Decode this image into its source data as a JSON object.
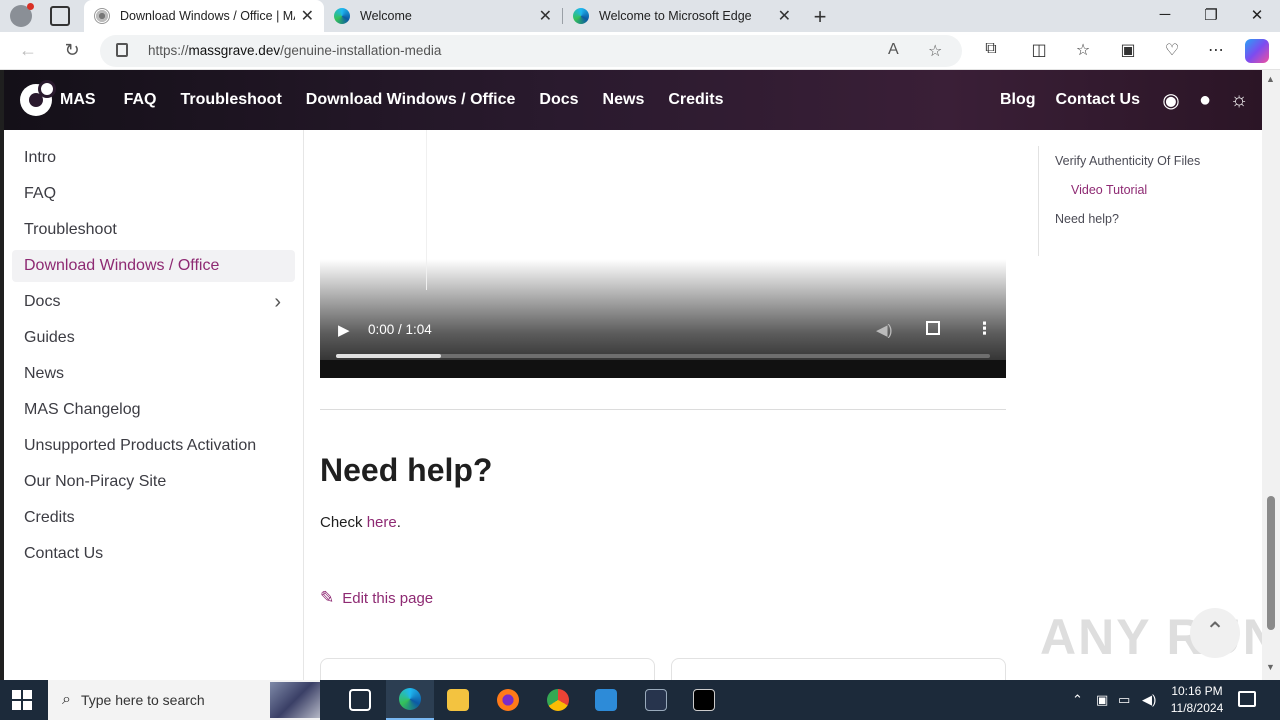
{
  "browser": {
    "tabs": [
      {
        "title": "Download Windows / Office | MAS",
        "active": true
      },
      {
        "title": "Welcome",
        "active": false
      },
      {
        "title": "Welcome to Microsoft Edge",
        "active": false
      }
    ],
    "url_prefix": "https://",
    "url_host": "massgrave.dev",
    "url_path": "/genuine-installation-media"
  },
  "site": {
    "brand": "MAS",
    "nav": [
      "FAQ",
      "Troubleshoot",
      "Download Windows / Office",
      "Docs",
      "News",
      "Credits"
    ],
    "nav_right": [
      "Blog",
      "Contact Us"
    ],
    "nav_icons": [
      "discord-icon",
      "github-icon",
      "theme-sun-icon"
    ],
    "accent_color": "#8e2a73"
  },
  "sidebar": {
    "items": [
      {
        "label": "Intro"
      },
      {
        "label": "FAQ"
      },
      {
        "label": "Troubleshoot"
      },
      {
        "label": "Download Windows / Office",
        "active": true
      },
      {
        "label": "Docs",
        "expandable": true
      },
      {
        "label": "Guides"
      },
      {
        "label": "News"
      },
      {
        "label": "MAS Changelog"
      },
      {
        "label": "Unsupported Products Activation"
      },
      {
        "label": "Our Non-Piracy Site"
      },
      {
        "label": "Credits"
      },
      {
        "label": "Contact Us"
      }
    ]
  },
  "video": {
    "time": "0:00 / 1:04",
    "buffered_fraction": 0.16
  },
  "content": {
    "heading": "Need help?",
    "check_text": "Check ",
    "link_text": "here",
    "period": ".",
    "edit_label": "Edit this page"
  },
  "toc": {
    "items": [
      {
        "label": "Verify Authenticity Of Files",
        "level": 1
      },
      {
        "label": "Video Tutorial",
        "level": 2
      },
      {
        "label": "Need help?",
        "level": 1
      }
    ]
  },
  "watermark": "ANY RUN",
  "taskbar": {
    "search_placeholder": "Type here to search",
    "time": "10:16 PM",
    "date": "11/8/2024"
  }
}
